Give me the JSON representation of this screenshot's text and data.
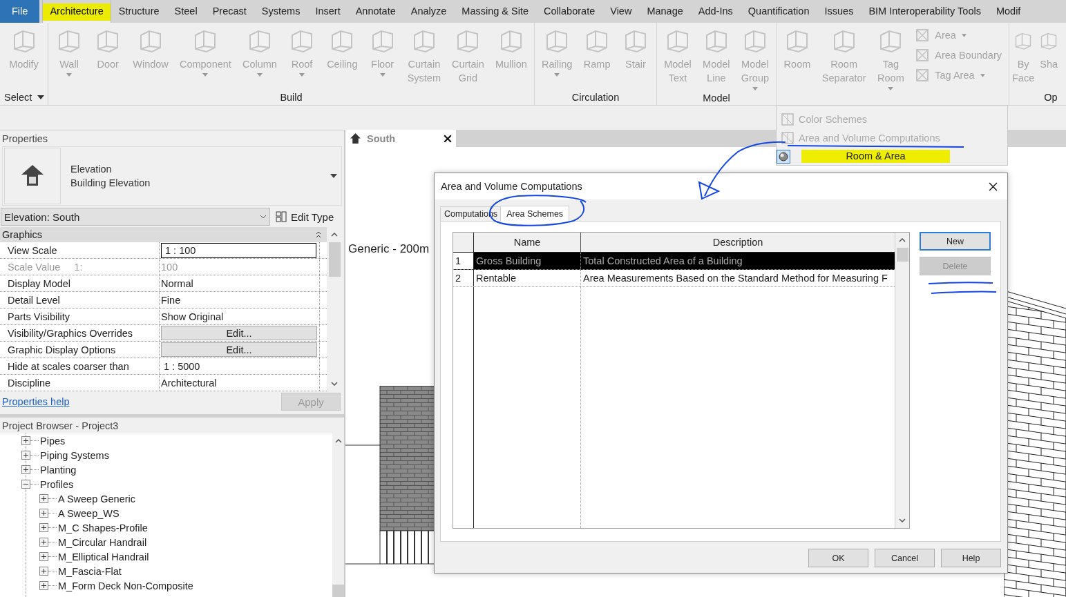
{
  "menu_tabs": [
    {
      "label": "File",
      "kind": "file",
      "selected": false,
      "highlighted": false
    },
    {
      "label": "Architecture",
      "kind": "tab",
      "selected": true,
      "highlighted": true
    },
    {
      "label": "Structure",
      "kind": "tab",
      "selected": false,
      "highlighted": false
    },
    {
      "label": "Steel",
      "kind": "tab",
      "selected": false,
      "highlighted": false
    },
    {
      "label": "Precast",
      "kind": "tab",
      "selected": false,
      "highlighted": false
    },
    {
      "label": "Systems",
      "kind": "tab",
      "selected": false,
      "highlighted": false
    },
    {
      "label": "Insert",
      "kind": "tab",
      "selected": false,
      "highlighted": false
    },
    {
      "label": "Annotate",
      "kind": "tab",
      "selected": false,
      "highlighted": false
    },
    {
      "label": "Analyze",
      "kind": "tab",
      "selected": false,
      "highlighted": false
    },
    {
      "label": "Massing & Site",
      "kind": "tab",
      "selected": false,
      "highlighted": false
    },
    {
      "label": "Collaborate",
      "kind": "tab",
      "selected": false,
      "highlighted": false
    },
    {
      "label": "View",
      "kind": "tab",
      "selected": false,
      "highlighted": false
    },
    {
      "label": "Manage",
      "kind": "tab",
      "selected": false,
      "highlighted": false
    },
    {
      "label": "Add-Ins",
      "kind": "tab",
      "selected": false,
      "highlighted": false
    },
    {
      "label": "Quantification",
      "kind": "tab",
      "selected": false,
      "highlighted": false
    },
    {
      "label": "Issues",
      "kind": "tab",
      "selected": false,
      "highlighted": false
    },
    {
      "label": "BIM Interoperability Tools",
      "kind": "tab",
      "selected": false,
      "highlighted": false
    },
    {
      "label": "Modif",
      "kind": "tab",
      "selected": false,
      "highlighted": false
    }
  ],
  "ribbon": {
    "disabled": true,
    "panels": [
      {
        "title": "Select",
        "title_dropdown": true,
        "tools": [
          {
            "label": "Modify",
            "dropdown": false
          }
        ]
      },
      {
        "title": "Build",
        "tools": [
          {
            "label": "Wall",
            "dropdown": true
          },
          {
            "label": "Door",
            "dropdown": false
          },
          {
            "label": "Window",
            "dropdown": false
          },
          {
            "label": "Component",
            "dropdown": true
          },
          {
            "label": "Column",
            "dropdown": true
          },
          {
            "label": "Roof",
            "dropdown": true
          },
          {
            "label": "Ceiling",
            "dropdown": false
          },
          {
            "label": "Floor",
            "dropdown": true
          },
          {
            "label": "Curtain System",
            "dropdown": false
          },
          {
            "label": "Curtain Grid",
            "dropdown": false
          },
          {
            "label": "Mullion",
            "dropdown": false
          }
        ]
      },
      {
        "title": "Circulation",
        "tools": [
          {
            "label": "Railing",
            "dropdown": true
          },
          {
            "label": "Ramp",
            "dropdown": false
          },
          {
            "label": "Stair",
            "dropdown": false
          }
        ]
      },
      {
        "title": "Model",
        "tools": [
          {
            "label": "Model Text",
            "dropdown": false
          },
          {
            "label": "Model Line",
            "dropdown": false
          },
          {
            "label": "Model Group",
            "dropdown": true
          }
        ]
      },
      {
        "tools": [
          {
            "label": "Room",
            "dropdown": false
          },
          {
            "label": "Room Separator",
            "dropdown": false
          },
          {
            "label": "Tag Room",
            "dropdown": true
          }
        ],
        "small_tools": [
          {
            "label": "Area",
            "dropdown": true
          },
          {
            "label": "Area Boundary",
            "dropdown": false
          },
          {
            "label": "Tag Area",
            "dropdown": true
          }
        ]
      },
      {
        "title": "Op",
        "tools": [
          {
            "label": "By Face",
            "dropdown": false
          },
          {
            "label": "Sha",
            "dropdown": false
          }
        ]
      }
    ]
  },
  "panel_menu": {
    "items": [
      {
        "label": "Color Schemes",
        "disabled": true,
        "highlighted": false
      },
      {
        "label": "Area and Volume Computations",
        "disabled": true,
        "highlighted": false
      },
      {
        "label": "Room & Area",
        "disabled": false,
        "highlighted": true
      }
    ]
  },
  "properties": {
    "title": "Properties",
    "type_family": "Elevation",
    "type_name": "Building Elevation",
    "instance": "Elevation: South",
    "edit_type": "Edit Type",
    "group": {
      "label": "Graphics",
      "expanded": true
    },
    "rows": [
      {
        "label": "View Scale",
        "suffix": "",
        "value": "1 : 100",
        "kind": "input",
        "disabled": false
      },
      {
        "label": "Scale Value",
        "suffix": "1:",
        "value": "100",
        "kind": "text",
        "disabled": true
      },
      {
        "label": "Display Model",
        "suffix": "",
        "value": "Normal",
        "kind": "text",
        "disabled": false
      },
      {
        "label": "Detail Level",
        "suffix": "",
        "value": "Fine",
        "kind": "text",
        "disabled": false
      },
      {
        "label": "Parts Visibility",
        "suffix": "",
        "value": "Show Original",
        "kind": "text",
        "disabled": false
      },
      {
        "label": "Visibility/Graphics Overrides",
        "suffix": "",
        "value": "Edit...",
        "kind": "button",
        "disabled": false
      },
      {
        "label": "Graphic Display Options",
        "suffix": "",
        "value": "Edit...",
        "kind": "button",
        "disabled": false
      },
      {
        "label": "Hide at scales coarser than",
        "suffix": "",
        "value": "1 : 5000",
        "kind": "input-plain",
        "disabled": false
      },
      {
        "label": "Discipline",
        "suffix": "",
        "value": "Architectural",
        "kind": "text",
        "disabled": false
      }
    ],
    "help": "Properties help",
    "apply": {
      "label": "Apply",
      "disabled": true
    }
  },
  "browser": {
    "title": "Project Browser - Project3",
    "items": [
      {
        "label": "Pipes",
        "expanded": false
      },
      {
        "label": "Piping Systems",
        "expanded": false
      },
      {
        "label": "Planting",
        "expanded": false
      },
      {
        "label": "Profiles",
        "expanded": true,
        "children": [
          {
            "label": "A Sweep Generic",
            "expanded": false
          },
          {
            "label": "A Sweep_WS",
            "expanded": false
          },
          {
            "label": "M_C Shapes-Profile",
            "expanded": false
          },
          {
            "label": "M_Circular Handrail",
            "expanded": false
          },
          {
            "label": "M_Elliptical Handrail",
            "expanded": false
          },
          {
            "label": "M_Fascia-Flat",
            "expanded": false
          },
          {
            "label": "M_Form Deck Non-Composite",
            "expanded": false
          }
        ]
      }
    ]
  },
  "view": {
    "tab": "South",
    "caption": "Generic - 200m"
  },
  "dialog": {
    "title": "Area and Volume Computations",
    "tabs": [
      {
        "label": "Computations",
        "selected": false
      },
      {
        "label": "Area Schemes",
        "selected": true
      }
    ],
    "columns": [
      "Name",
      "Description"
    ],
    "rows": [
      {
        "number": "1",
        "name": "Gross Building",
        "description": "Total Constructed Area of a Building",
        "selected": true
      },
      {
        "number": "2",
        "name": "Rentable",
        "description": "Area Measurements Based on the Standard Method for Measuring F",
        "selected": false
      }
    ],
    "side_buttons": [
      {
        "label": "New",
        "disabled": false,
        "focused": true
      },
      {
        "label": "Delete",
        "disabled": true,
        "focused": false
      }
    ],
    "footer_buttons": [
      "OK",
      "Cancel",
      "Help"
    ]
  }
}
